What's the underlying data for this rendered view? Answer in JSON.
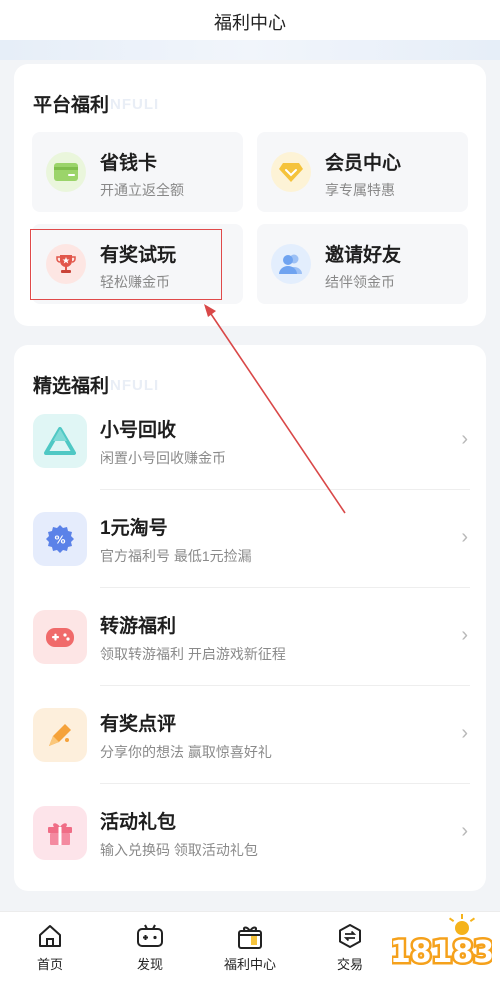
{
  "header": {
    "title": "福利中心"
  },
  "platform": {
    "title": "平台福利",
    "watermark": "NFULI",
    "tiles": [
      {
        "title": "省钱卡",
        "sub": "开通立返全额",
        "icon": "card-icon",
        "color": "#9bd46a"
      },
      {
        "title": "会员中心",
        "sub": "享专属特惠",
        "icon": "diamond-icon",
        "color": "#f5c33b"
      },
      {
        "title": "有奖试玩",
        "sub": "轻松赚金币",
        "icon": "trophy-icon",
        "color": "#e2564a"
      },
      {
        "title": "邀请好友",
        "sub": "结伴领金币",
        "icon": "friends-icon",
        "color": "#6fa3f0"
      }
    ]
  },
  "selected": {
    "title": "精选福利",
    "watermark": "NFULI",
    "items": [
      {
        "title": "小号回收",
        "sub": "闲置小号回收赚金币",
        "icon": "recycle-icon",
        "color": "#4fc8c4"
      },
      {
        "title": "1元淘号",
        "sub": "官方福利号 最低1元捡漏",
        "icon": "discount-icon",
        "color": "#5b82e8"
      },
      {
        "title": "转游福利",
        "sub": "领取转游福利 开启游戏新征程",
        "icon": "gamepad-icon",
        "color": "#f06a6a"
      },
      {
        "title": "有奖点评",
        "sub": "分享你的想法 赢取惊喜好礼",
        "icon": "pen-icon",
        "color": "#f5a23a"
      },
      {
        "title": "活动礼包",
        "sub": "输入兑换码 领取活动礼包",
        "icon": "gift-icon",
        "color": "#f06d86"
      }
    ]
  },
  "tabbar": {
    "tabs": [
      {
        "label": "首页",
        "icon": "home-icon"
      },
      {
        "label": "发现",
        "icon": "gamepad-icon"
      },
      {
        "label": "福利中心",
        "icon": "gift-icon"
      },
      {
        "label": "交易",
        "icon": "exchange-icon"
      }
    ],
    "logo": "18183"
  },
  "colors": {
    "highlight": "#e04a4a",
    "arrow": "#d94848"
  }
}
